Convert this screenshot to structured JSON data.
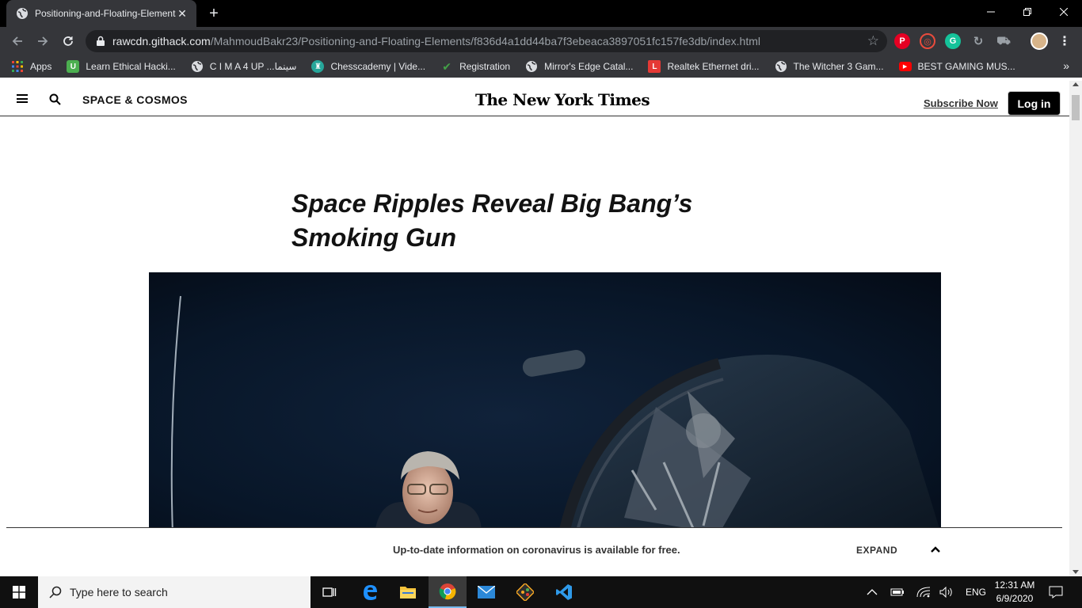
{
  "browser": {
    "tab_title": "Positioning-and-Floating-Elements",
    "url_host": "rawcdn.githack.com",
    "url_path": "/MahmoudBakr23/Positioning-and-Floating-Elements/f836d4a1dd44ba7f3ebeaca3897051fc157fe3db/index.html",
    "bookmarks": [
      {
        "label": "Apps",
        "icon": "apps-grid-icon",
        "color": "#e53935"
      },
      {
        "label": "Learn Ethical Hacki...",
        "icon": "udemy-icon",
        "color": "#4caf50"
      },
      {
        "label": "C I M A 4 UP ...سينما",
        "icon": "globe-icon",
        "color": "#5f6368"
      },
      {
        "label": "Chesscademy | Vide...",
        "icon": "chess-icon",
        "color": "#26a69a"
      },
      {
        "label": "Registration",
        "icon": "check-icon",
        "color": "#43a047"
      },
      {
        "label": "Mirror's Edge Catal...",
        "icon": "globe-icon",
        "color": "#5f6368"
      },
      {
        "label": "Realtek Ethernet dri...",
        "icon": "l-icon",
        "color": "#e53935"
      },
      {
        "label": "The Witcher 3 Gam...",
        "icon": "globe-icon",
        "color": "#5f6368"
      },
      {
        "label": "BEST GAMING MUS...",
        "icon": "youtube-icon",
        "color": "#ff0000"
      }
    ]
  },
  "nyt": {
    "section": "SPACE & COSMOS",
    "masthead": "The New York Times",
    "subscribe": "Subscribe Now",
    "login": "Log in",
    "headline": "Space Ripples Reveal Big Bang’s Smoking Gun",
    "banner_text": "Up-to-date information on coronavirus is available for free.",
    "expand": "EXPAND"
  },
  "taskbar": {
    "search_placeholder": "Type here to search",
    "language": "ENG",
    "time": "12:31 AM",
    "date": "6/9/2020"
  }
}
